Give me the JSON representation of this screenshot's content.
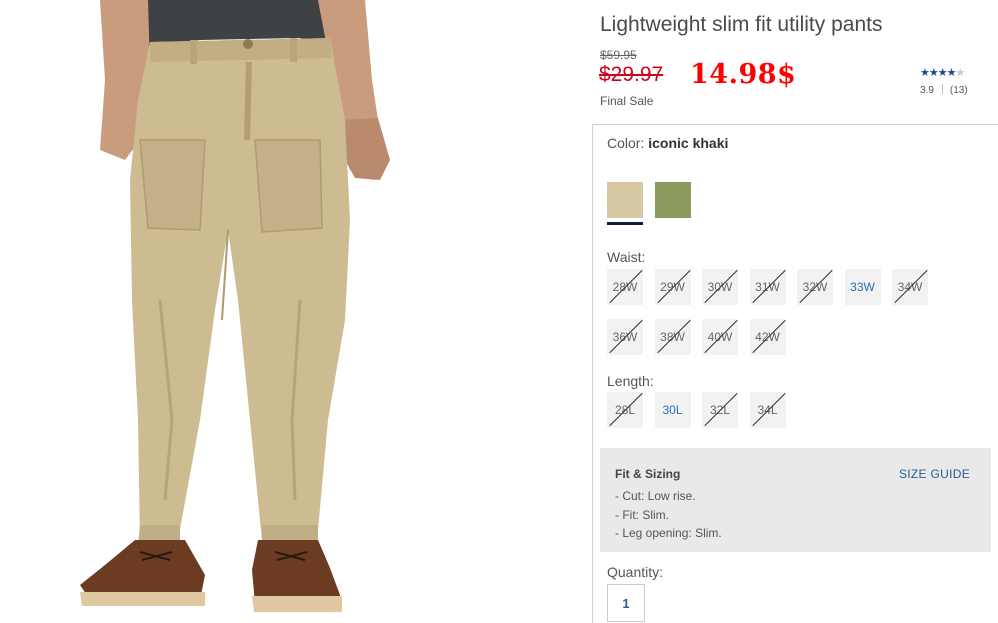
{
  "product": {
    "title": "Lightweight slim fit utility pants",
    "price_original": "$59.95",
    "price_sale": "$29.97",
    "price_new": "14.98$",
    "final_sale": "Final Sale",
    "rating_value": "3.9",
    "rating_count": "(13)",
    "stars_filled": 4,
    "stars_total": 5
  },
  "color": {
    "label": "Color:",
    "selected": "iconic khaki",
    "swatches": [
      {
        "name": "iconic khaki",
        "hex": "#d6c9a4",
        "selected": true
      },
      {
        "name": "olive",
        "hex": "#8c9b5d",
        "selected": false
      }
    ]
  },
  "waist": {
    "label": "Waist:",
    "sizes": [
      {
        "label": "28W",
        "available": false
      },
      {
        "label": "29W",
        "available": false
      },
      {
        "label": "30W",
        "available": false
      },
      {
        "label": "31W",
        "available": false
      },
      {
        "label": "32W",
        "available": false
      },
      {
        "label": "33W",
        "available": true
      },
      {
        "label": "34W",
        "available": false
      },
      {
        "label": "36W",
        "available": false
      },
      {
        "label": "38W",
        "available": false
      },
      {
        "label": "40W",
        "available": false
      },
      {
        "label": "42W",
        "available": false
      }
    ]
  },
  "length": {
    "label": "Length:",
    "sizes": [
      {
        "label": "28L",
        "available": false
      },
      {
        "label": "30L",
        "available": true
      },
      {
        "label": "32L",
        "available": false
      },
      {
        "label": "34L",
        "available": false
      }
    ]
  },
  "fit": {
    "title": "Fit & Sizing",
    "size_guide": "SIZE GUIDE",
    "items": [
      "- Cut: Low rise.",
      "- Fit: Slim.",
      "- Leg opening: Slim."
    ]
  },
  "quantity": {
    "label": "Quantity:",
    "value": "1"
  },
  "colors": {
    "sale_red": "#d0021b",
    "star_blue": "#1a4b8c",
    "link_blue": "#2b5b93"
  }
}
